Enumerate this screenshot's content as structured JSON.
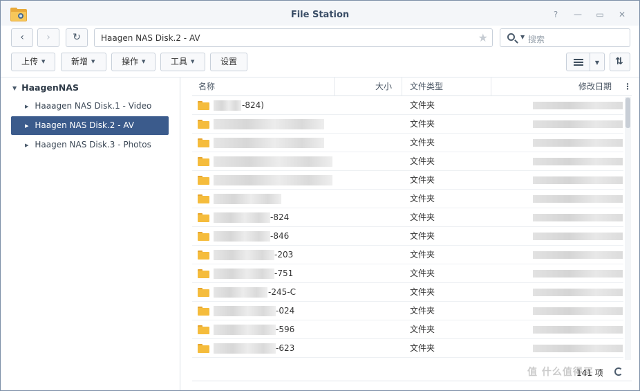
{
  "window": {
    "title": "File Station"
  },
  "titlebar": {
    "buttons": [
      {
        "name": "help-button",
        "glyph": "?"
      },
      {
        "name": "minimize-button",
        "glyph": "—"
      },
      {
        "name": "maximize-button",
        "glyph": "▭"
      },
      {
        "name": "close-button",
        "glyph": "✕"
      }
    ]
  },
  "nav": {
    "back_glyph": "‹",
    "forward_glyph": "›",
    "refresh_glyph": "↻",
    "path": "Haagen NAS Disk.2 - AV",
    "star_glyph": "★",
    "search_placeholder": "搜索"
  },
  "toolbar": {
    "upload": "上传",
    "create": "新增",
    "action": "操作",
    "tools": "工具",
    "settings": "设置",
    "sort_glyph": "⇅"
  },
  "sidebar": {
    "root": "HaagenNAS",
    "items": [
      {
        "label": "Haaagen NAS Disk.1 - Video",
        "selected": false
      },
      {
        "label": "Haagen NAS Disk.2 - AV",
        "selected": true
      },
      {
        "label": "Haagen NAS Disk.3 - Photos",
        "selected": false
      }
    ]
  },
  "list": {
    "columns": {
      "name": "名称",
      "size": "大小",
      "type": "文件类型",
      "modified": "修改日期"
    },
    "menu_glyph": "⋮",
    "rows": [
      {
        "visible_name": "-824)",
        "type": "文件夹"
      },
      {
        "visible_name": "",
        "type": "文件夹"
      },
      {
        "visible_name": "",
        "type": "文件夹"
      },
      {
        "visible_name": "",
        "type": "文件夹"
      },
      {
        "visible_name": "",
        "type": "文件夹"
      },
      {
        "visible_name": "",
        "type": "文件夹"
      },
      {
        "visible_name": "-824",
        "type": "文件夹"
      },
      {
        "visible_name": "-846",
        "type": "文件夹"
      },
      {
        "visible_name": "-203",
        "type": "文件夹"
      },
      {
        "visible_name": "-751",
        "type": "文件夹"
      },
      {
        "visible_name": "-245-C",
        "type": "文件夹"
      },
      {
        "visible_name": "-024",
        "type": "文件夹"
      },
      {
        "visible_name": "-596",
        "type": "文件夹"
      },
      {
        "visible_name": "-623",
        "type": "文件夹"
      }
    ]
  },
  "status": {
    "count": "141 项"
  },
  "watermark": "值 什么值得买"
}
